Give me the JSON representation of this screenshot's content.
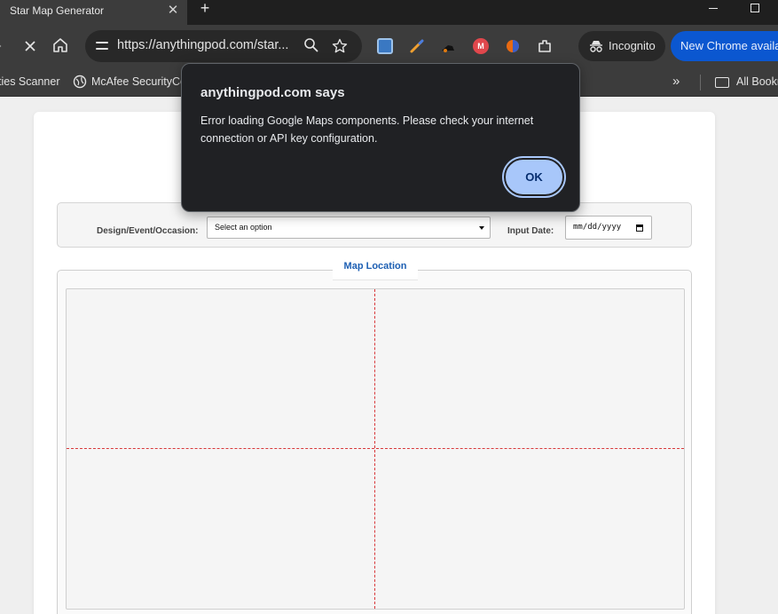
{
  "browser": {
    "tab": {
      "title": "Star Map Generator",
      "close": "✕"
    },
    "new_tab": "+",
    "omnibox": {
      "url": "https://anythingpod.com/star..."
    },
    "incognito_label": "Incognito",
    "update_label": "New Chrome available"
  },
  "bookmarks": {
    "items": [
      {
        "label": "ties Scanner"
      },
      {
        "label": "McAfee SecurityCen"
      }
    ],
    "all_bookmarks": "All Bookm"
  },
  "form": {
    "design_label": "Design/Event/Occasion:",
    "design_select_value": "Select an option",
    "date_label": "Input Date:",
    "date_value": "mm/dd/yyyy"
  },
  "map": {
    "legend": "Map Location",
    "crosshair_color": "#d8383a"
  },
  "dialog": {
    "title": "anythingpod.com says",
    "message": "Error loading Google Maps components. Please check your internet connection or API key configuration.",
    "ok_label": "OK"
  },
  "colors": {
    "accent": "#1d5fb3",
    "ok_button": "#a8c7fa",
    "update_pill": "#0b57d0"
  }
}
